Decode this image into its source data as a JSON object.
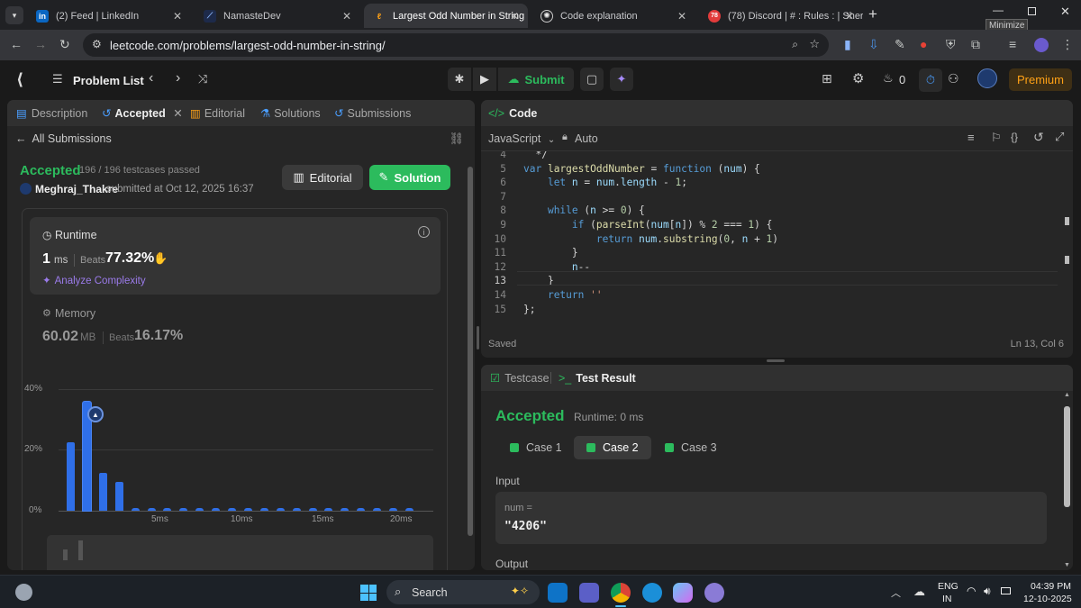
{
  "browser": {
    "tabs": [
      {
        "title": "(2) Feed | LinkedIn",
        "icon": "linkedin-icon"
      },
      {
        "title": "NamasteDev",
        "icon": "namastedev-icon"
      },
      {
        "title": "Largest Odd Number in String",
        "icon": "leetcode-icon"
      },
      {
        "title": "Code explanation",
        "icon": "chatgpt-icon"
      },
      {
        "title": "(78) Discord | # : Rules : | Sher",
        "icon": "discord-icon",
        "badge": "78"
      }
    ],
    "new_tab": "+",
    "minimize_tooltip": "Minimize",
    "url": "leetcode.com/problems/largest-odd-number-in-string/"
  },
  "nav": {
    "problem_list": "Problem List",
    "submit": "Submit",
    "streak": "0",
    "premium": "Premium"
  },
  "left": {
    "tabs": [
      "Description",
      "Accepted",
      "Editorial",
      "Solutions",
      "Submissions"
    ],
    "all_submissions": "All Submissions",
    "status": "Accepted",
    "testcases": "196 / 196 testcases passed",
    "user": "Meghraj_Thakre",
    "submitted": "submitted at Oct 12, 2025 16:37",
    "editorial_btn": "Editorial",
    "solution_btn": "Solution",
    "runtime": {
      "label": "Runtime",
      "value": "1",
      "unit": "ms",
      "beats_label": "Beats",
      "beats": "77.32%",
      "analyze": "Analyze Complexity"
    },
    "memory": {
      "label": "Memory",
      "value": "60.02",
      "unit": "MB",
      "beats_label": "Beats",
      "beats": "16.17%"
    }
  },
  "chart_data": {
    "type": "bar",
    "yticks": [
      "40%",
      "20%",
      "0%"
    ],
    "xticks": [
      "5ms",
      "10ms",
      "15ms",
      "20ms"
    ],
    "ylim": [
      0,
      40
    ],
    "values": [
      22.5,
      36,
      12.5,
      9.5,
      0.5,
      0.5,
      0.5,
      0.5,
      0.5,
      0.5,
      0.5,
      0.5,
      0.5,
      0.5,
      0.5,
      0.5,
      0.5,
      0.5,
      0.5,
      0.5,
      0.5,
      0.5
    ],
    "highlight_index": 1,
    "color": "#2f6fe8"
  },
  "code": {
    "title": "Code",
    "language": "JavaScript",
    "mode": "Auto",
    "lines": [
      {
        "n": "4",
        "text": "  */"
      },
      {
        "n": "5",
        "text": "var largestOddNumber = function (num) {"
      },
      {
        "n": "6",
        "text": "    let n = num.length - 1;"
      },
      {
        "n": "7",
        "text": ""
      },
      {
        "n": "8",
        "text": "    while (n >= 0) {"
      },
      {
        "n": "9",
        "text": "        if (parseInt(num[n]) % 2 === 1) {"
      },
      {
        "n": "10",
        "text": "            return num.substring(0, n + 1)"
      },
      {
        "n": "11",
        "text": "        }"
      },
      {
        "n": "12",
        "text": "        n--"
      },
      {
        "n": "13",
        "text": "    }"
      },
      {
        "n": "14",
        "text": "    return ''"
      },
      {
        "n": "15",
        "text": "};"
      }
    ],
    "saved": "Saved",
    "position": "Ln 13, Col 6"
  },
  "result": {
    "tab_testcase": "Testcase",
    "tab_result": "Test Result",
    "status": "Accepted",
    "runtime": "Runtime: 0 ms",
    "cases": [
      "Case 1",
      "Case 2",
      "Case 3"
    ],
    "input_label": "Input",
    "var_label": "num =",
    "var_value": "\"4206\"",
    "output_label": "Output"
  },
  "taskbar": {
    "search": "Search",
    "lang": "ENG",
    "region": "IN",
    "time": "04:39 PM",
    "date": "12-10-2025"
  },
  "colors": {
    "accent_green": "#2cbb5d",
    "premium": "#ffa116",
    "bar_blue": "#2f6fe8"
  }
}
